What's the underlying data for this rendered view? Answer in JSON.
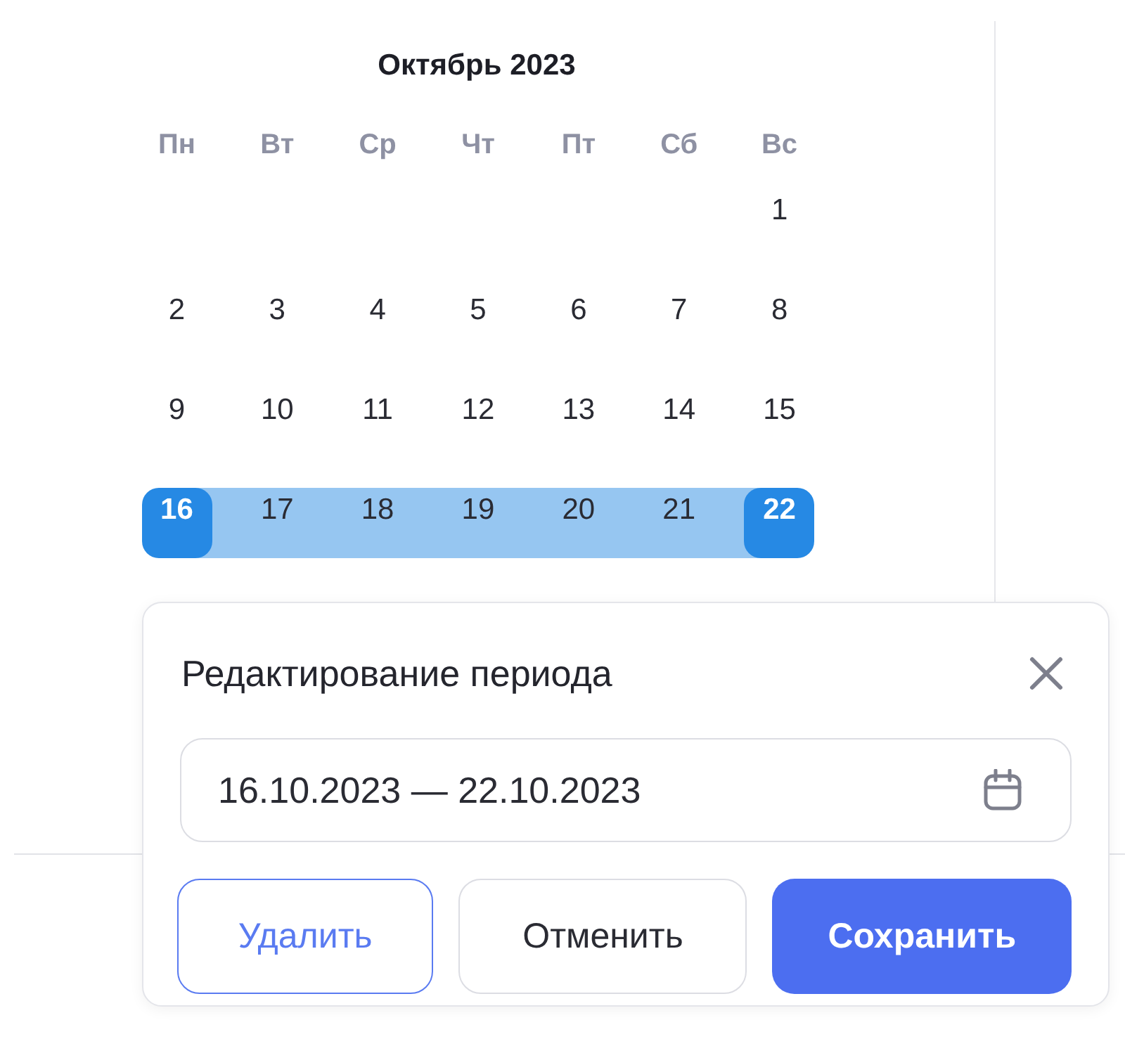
{
  "calendar": {
    "title": "Октябрь 2023",
    "weekdays": [
      "Пн",
      "Вт",
      "Ср",
      "Чт",
      "Пт",
      "Сб",
      "Вс"
    ],
    "weeks": [
      [
        {
          "day": "1",
          "selected": false,
          "in_range": false
        }
      ],
      [
        {
          "day": "2",
          "selected": false,
          "in_range": false
        },
        {
          "day": "3",
          "selected": false,
          "in_range": false
        },
        {
          "day": "4",
          "selected": false,
          "in_range": false
        },
        {
          "day": "5",
          "selected": false,
          "in_range": false
        },
        {
          "day": "6",
          "selected": false,
          "in_range": false
        },
        {
          "day": "7",
          "selected": false,
          "in_range": false
        },
        {
          "day": "8",
          "selected": false,
          "in_range": false
        }
      ],
      [
        {
          "day": "9",
          "selected": false,
          "in_range": false
        },
        {
          "day": "10",
          "selected": false,
          "in_range": false
        },
        {
          "day": "11",
          "selected": false,
          "in_range": false
        },
        {
          "day": "12",
          "selected": false,
          "in_range": false
        },
        {
          "day": "13",
          "selected": false,
          "in_range": false
        },
        {
          "day": "14",
          "selected": false,
          "in_range": false
        },
        {
          "day": "15",
          "selected": false,
          "in_range": false
        }
      ],
      [
        {
          "day": "16",
          "selected": true,
          "in_range": true
        },
        {
          "day": "17",
          "selected": false,
          "in_range": true
        },
        {
          "day": "18",
          "selected": false,
          "in_range": true
        },
        {
          "day": "19",
          "selected": false,
          "in_range": true
        },
        {
          "day": "20",
          "selected": false,
          "in_range": true
        },
        {
          "day": "21",
          "selected": false,
          "in_range": true
        },
        {
          "day": "22",
          "selected": true,
          "in_range": true
        }
      ]
    ]
  },
  "popup": {
    "title": "Редактирование периода",
    "period_field": {
      "value": "16.10.2023 — 22.10.2023"
    },
    "buttons": [
      {
        "label": "Удалить",
        "kind": "outline"
      },
      {
        "label": "Отменить",
        "kind": "secondary"
      },
      {
        "label": "Сохранить",
        "kind": "primary"
      }
    ]
  }
}
